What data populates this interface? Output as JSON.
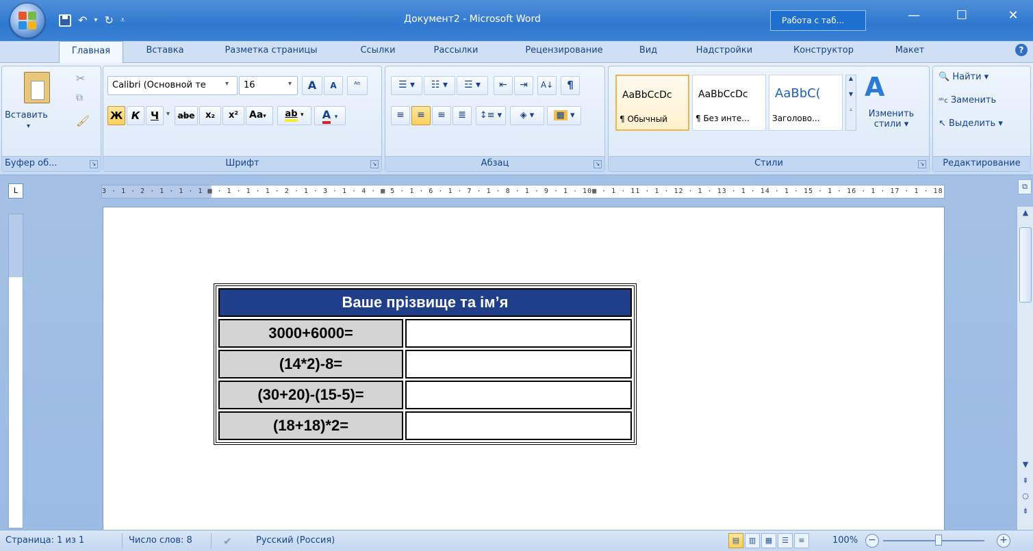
{
  "window": {
    "title": "Документ2 - Microsoft Word",
    "context_tab": "Работа с таб...",
    "controls": {
      "minimize": "—",
      "maximize": "☐",
      "close": "✕"
    }
  },
  "tabs": [
    {
      "label": "Главная",
      "active": true
    },
    {
      "label": "Вставка"
    },
    {
      "label": "Разметка страницы"
    },
    {
      "label": "Ссылки"
    },
    {
      "label": "Рассылки"
    },
    {
      "label": "Рецензирование"
    },
    {
      "label": "Вид"
    },
    {
      "label": "Надстройки"
    },
    {
      "label": "Конструктор"
    },
    {
      "label": "Макет"
    }
  ],
  "ribbon": {
    "clipboard": {
      "paste_label": "Вставить",
      "group_label": "Буфер об..."
    },
    "font": {
      "font_name": "Calibri (Основной те",
      "font_size": "16",
      "grow": "A",
      "shrink": "A",
      "bold": "Ж",
      "italic": "К",
      "underline": "Ч",
      "strike": "abe",
      "subscript": "x₂",
      "superscript": "x²",
      "case": "Aa",
      "highlight": "ab",
      "color": "A",
      "group_label": "Шрифт"
    },
    "paragraph": {
      "group_label": "Абзац",
      "pilcrow": "¶"
    },
    "styles": {
      "items": [
        {
          "sample": "AaBbCcDc",
          "name": "¶ Обычный"
        },
        {
          "sample": "AaBbCcDc",
          "name": "¶ Без инте..."
        },
        {
          "sample": "AaBbC(",
          "name": "Заголово..."
        }
      ],
      "change_label": "Изменить",
      "change_label2": "стили ▾",
      "group_label": "Стили"
    },
    "editing": {
      "find": "Найти ▾",
      "replace": "Заменить",
      "select": "Выделить ▾",
      "group_label": "Редактирование"
    }
  },
  "ruler": {
    "text": "3 · 1 · 2 · 1 · 1 · 1 ▦ · 1 · 1 · 1 · 2 · 1 · 3 · 1 · 4 · ▦ 5 · 1 · 6 · 1 · 7 · 1 · 8 · 1 · 9 · 1 · 10▦ · 1 · 11 · 1 · 12 · 1 · 13 · 1 · 14 · 1 · 15 · 1 · 16 · 1 · 17 · 1 · 18",
    "tab_selector": "L"
  },
  "table": {
    "header": "Ваше прізвище та ім’я",
    "rows": [
      {
        "label": "3000+6000=",
        "answer": ""
      },
      {
        "label": "(14*2)-8=",
        "answer": ""
      },
      {
        "label": "(30+20)-(15-5)=",
        "answer": ""
      },
      {
        "label": "(18+18)*2=",
        "answer": ""
      }
    ]
  },
  "status": {
    "page": "Страница: 1 из 1",
    "words": "Число слов: 8",
    "language": "Русский (Россия)",
    "zoom": "100%",
    "zoom_level": 1.0
  },
  "colors": {
    "title_bar": "#2f78d0",
    "table_header": "#1f3f8a",
    "table_label_cell": "#d4d4d4"
  }
}
